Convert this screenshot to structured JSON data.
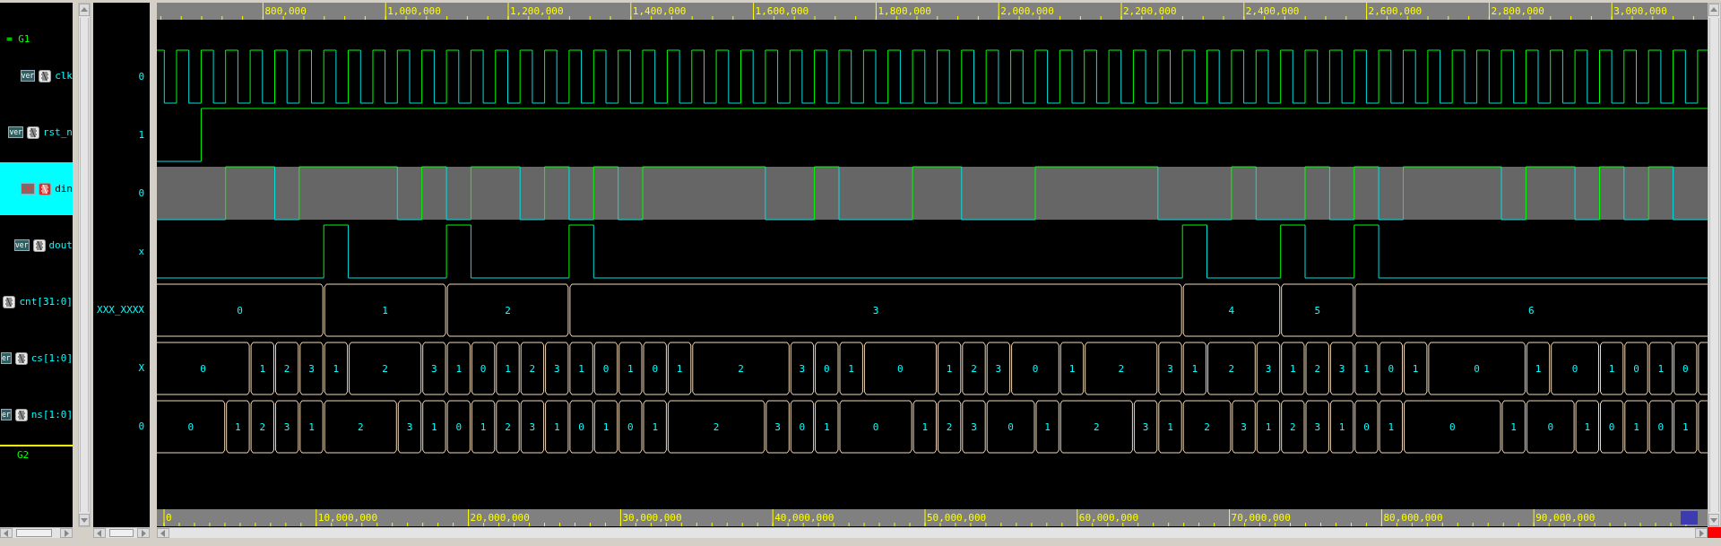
{
  "group_1": {
    "label": "= G1"
  },
  "signals": [
    {
      "name": "clk",
      "badge": "ver",
      "value": "0",
      "selected": false,
      "kind": "clock"
    },
    {
      "name": "rst_n",
      "badge": "ver",
      "value": "1",
      "selected": false,
      "kind": "bit"
    },
    {
      "name": "din",
      "badge": "ver",
      "value": "0",
      "selected": true,
      "kind": "bit"
    },
    {
      "name": "dout",
      "badge": "ver",
      "value": "x",
      "selected": false,
      "kind": "bit"
    },
    {
      "name": "cnt[31:0]",
      "value": "XXX_XXXX",
      "selected": false,
      "kind": "bus",
      "segments": [
        "0",
        "1",
        "2",
        "3",
        "4",
        "5",
        "6"
      ]
    },
    {
      "name": "cs[1:0]",
      "badge": "er",
      "value": "X",
      "selected": false,
      "kind": "bus",
      "segments": [
        "0",
        "1",
        "2",
        "3",
        "1",
        "2",
        "3",
        "1",
        "0",
        "1",
        "2",
        "3",
        "1",
        "0",
        "1",
        "0",
        "1",
        "2",
        "3",
        "0",
        "1",
        "0",
        "1",
        "2",
        "3",
        "0",
        "1",
        "2",
        "3",
        "1",
        "2",
        "3",
        "1",
        "2",
        "3",
        "1",
        "0",
        "1",
        "0",
        "1",
        "0",
        "1",
        "0",
        "1",
        "0"
      ]
    },
    {
      "name": "ns[1:0]",
      "badge": "er",
      "value": "0",
      "selected": false,
      "kind": "bus",
      "segments": [
        "0",
        "1",
        "2",
        "3",
        "1",
        "2",
        "3",
        "1",
        "0",
        "1",
        "2",
        "3",
        "1",
        "0",
        "1",
        "0",
        "1",
        "2",
        "3",
        "0",
        "1",
        "0",
        "1",
        "2",
        "3",
        "0",
        "1",
        "2",
        "3",
        "1",
        "2",
        "3",
        "1",
        "2",
        "3",
        "1",
        "0",
        "1",
        "0",
        "1",
        "0",
        "1",
        "0",
        "1",
        "0",
        "1"
      ]
    }
  ],
  "group_2": {
    "label": "G2"
  },
  "top_ruler": {
    "labels": [
      "800,000",
      "1,000,000",
      "1,200,000",
      "1,400,000",
      "1,600,000",
      "1,800,000",
      "2,000,000",
      "2,200,000",
      "2,400,000",
      "2,600,000",
      "2,800,000",
      "3,000,000"
    ]
  },
  "bottom_ruler": {
    "labels": [
      "0",
      "10,000,000",
      "20,000,000",
      "30,000,000",
      "40,000,000",
      "50,000,000",
      "60,000,000",
      "70,000,000",
      "80,000,000",
      "90,000,000"
    ]
  }
}
